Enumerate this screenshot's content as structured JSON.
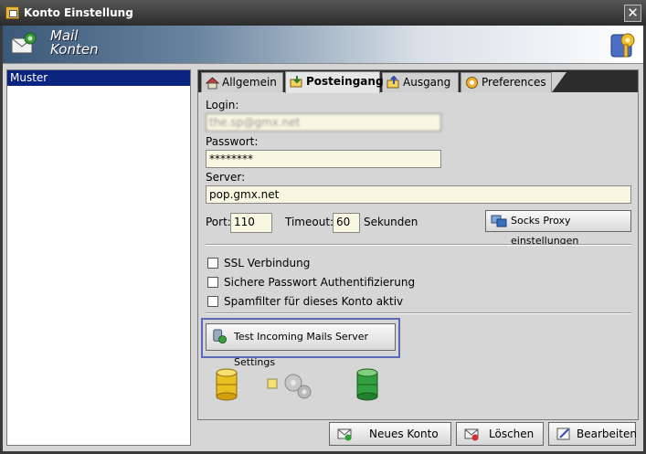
{
  "window": {
    "title": "Konto Einstellung",
    "close_glyph": "✕"
  },
  "banner": {
    "title_line1": "Mail",
    "title_line2": "Konten"
  },
  "accounts": [
    {
      "label": "Muster"
    }
  ],
  "tabs": [
    {
      "label": "Allgemein",
      "icon": "house-icon"
    },
    {
      "label": "Posteingang",
      "icon": "inbox-icon",
      "active": true
    },
    {
      "label": "Ausgang",
      "icon": "outbox-icon"
    },
    {
      "label": "Preferences",
      "icon": "preferences-icon"
    }
  ],
  "form": {
    "login_label": "Login:",
    "login_value": "the.sp@gmx.net",
    "password_label": "Passwort:",
    "password_value": "********",
    "server_label": "Server:",
    "server_value": "pop.gmx.net",
    "port_label": "Port:",
    "port_value": "110",
    "timeout_label": "Timeout:",
    "timeout_value": "60",
    "timeout_unit": "Sekunden",
    "socks_button": "Socks Proxy einstellungen",
    "ssl_label": "SSL Verbindung",
    "secure_auth_label": "Sichere Passwort Authentifizierung",
    "spamfilter_label": "Spamfilter für dieses Konto aktiv",
    "test_button": "Test Incoming Mails Server Settings"
  },
  "footer": {
    "new_account": "Neues Konto",
    "delete": "Löschen",
    "edit": "Bearbeiten"
  },
  "colors": {
    "selection": "#0b2480",
    "field_bg": "#f7f7e2",
    "focus_frame": "#5a6ab8"
  }
}
